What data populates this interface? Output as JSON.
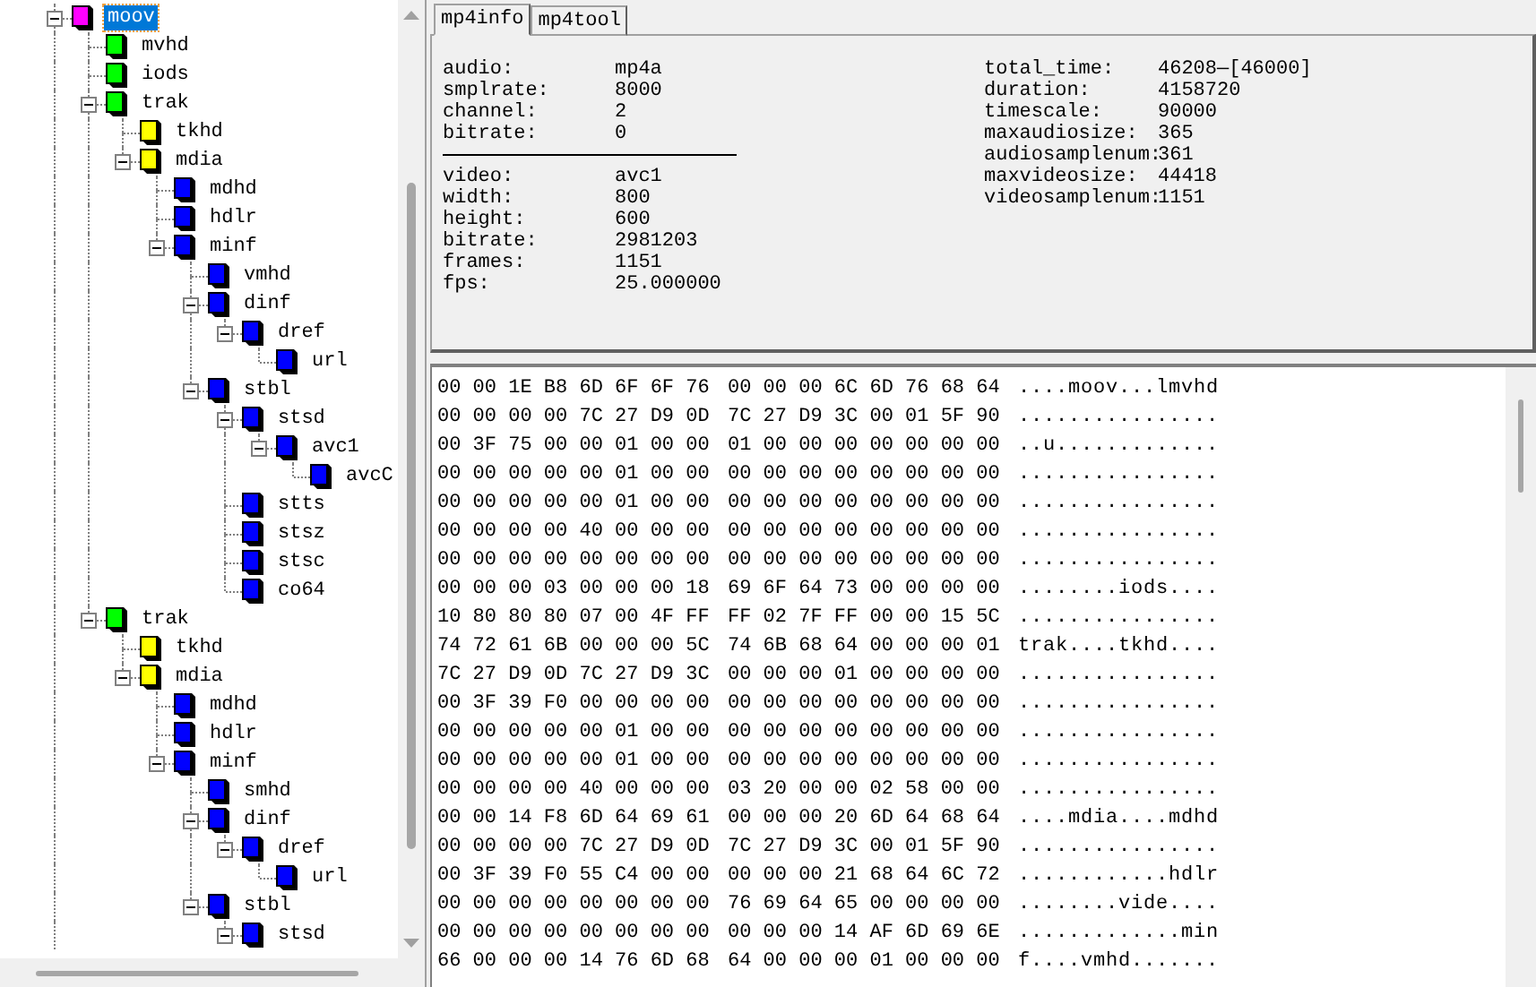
{
  "tree": [
    {
      "label": "moov",
      "color": "#ff00ff",
      "selected": true,
      "expanded": true,
      "children": [
        {
          "label": "mvhd",
          "color": "#00ff00",
          "selected": false
        },
        {
          "label": "iods",
          "color": "#00ff00",
          "selected": false
        },
        {
          "label": "trak",
          "color": "#00ff00",
          "selected": false,
          "expanded": true,
          "children": [
            {
              "label": "tkhd",
              "color": "#ffff00",
              "selected": false
            },
            {
              "label": "mdia",
              "color": "#ffff00",
              "selected": false,
              "expanded": true,
              "children": [
                {
                  "label": "mdhd",
                  "color": "#0000ff",
                  "selected": false
                },
                {
                  "label": "hdlr",
                  "color": "#0000ff",
                  "selected": false
                },
                {
                  "label": "minf",
                  "color": "#0000ff",
                  "selected": false,
                  "expanded": true,
                  "children": [
                    {
                      "label": "vmhd",
                      "color": "#0000ff",
                      "selected": false
                    },
                    {
                      "label": "dinf",
                      "color": "#0000ff",
                      "selected": false,
                      "expanded": true,
                      "children": [
                        {
                          "label": "dref",
                          "color": "#0000ff",
                          "selected": false,
                          "expanded": true,
                          "children": [
                            {
                              "label": "url",
                              "color": "#0000ff",
                              "selected": false
                            }
                          ]
                        }
                      ]
                    },
                    {
                      "label": "stbl",
                      "color": "#0000ff",
                      "selected": false,
                      "expanded": true,
                      "children": [
                        {
                          "label": "stsd",
                          "color": "#0000ff",
                          "selected": false,
                          "expanded": true,
                          "children": [
                            {
                              "label": "avc1",
                              "color": "#0000ff",
                              "selected": false,
                              "expanded": true,
                              "children": [
                                {
                                  "label": "avcC",
                                  "color": "#0000ff",
                                  "selected": false
                                }
                              ]
                            }
                          ]
                        },
                        {
                          "label": "stts",
                          "color": "#0000ff",
                          "selected": false
                        },
                        {
                          "label": "stsz",
                          "color": "#0000ff",
                          "selected": false
                        },
                        {
                          "label": "stsc",
                          "color": "#0000ff",
                          "selected": false
                        },
                        {
                          "label": "co64",
                          "color": "#0000ff",
                          "selected": false
                        }
                      ]
                    }
                  ]
                }
              ]
            }
          ]
        },
        {
          "label": "trak",
          "color": "#00ff00",
          "selected": false,
          "expanded": true,
          "children": [
            {
              "label": "tkhd",
              "color": "#ffff00",
              "selected": false
            },
            {
              "label": "mdia",
              "color": "#ffff00",
              "selected": false,
              "expanded": true,
              "children": [
                {
                  "label": "mdhd",
                  "color": "#0000ff",
                  "selected": false
                },
                {
                  "label": "hdlr",
                  "color": "#0000ff",
                  "selected": false
                },
                {
                  "label": "minf",
                  "color": "#0000ff",
                  "selected": false,
                  "expanded": true,
                  "children": [
                    {
                      "label": "smhd",
                      "color": "#0000ff",
                      "selected": false
                    },
                    {
                      "label": "dinf",
                      "color": "#0000ff",
                      "selected": false,
                      "expanded": true,
                      "children": [
                        {
                          "label": "dref",
                          "color": "#0000ff",
                          "selected": false,
                          "expanded": true,
                          "children": [
                            {
                              "label": "url",
                              "color": "#0000ff",
                              "selected": false
                            }
                          ]
                        }
                      ]
                    },
                    {
                      "label": "stbl",
                      "color": "#0000ff",
                      "selected": false,
                      "expanded": true,
                      "children": [
                        {
                          "label": "stsd",
                          "color": "#0000ff",
                          "selected": false,
                          "expanded": true
                        }
                      ]
                    }
                  ]
                }
              ]
            }
          ]
        }
      ]
    }
  ],
  "tabs": [
    {
      "label": "mp4info",
      "selected": true
    },
    {
      "label": "mp4tool",
      "selected": false
    }
  ],
  "info": {
    "audio": [
      {
        "label": "audio:",
        "value": "mp4a"
      },
      {
        "label": "smplrate:",
        "value": "8000"
      },
      {
        "label": "channel:",
        "value": "2"
      },
      {
        "label": "bitrate:",
        "value": "0"
      }
    ],
    "video": [
      {
        "label": "video:",
        "value": "avc1"
      },
      {
        "label": "width:",
        "value": "800"
      },
      {
        "label": "height:",
        "value": "600"
      },
      {
        "label": "bitrate:",
        "value": "2981203"
      },
      {
        "label": "frames:",
        "value": "1151"
      },
      {
        "label": "fps:",
        "value": "25.000000"
      }
    ],
    "summary": [
      {
        "label": "total_time:",
        "value": "46208—[46000]"
      },
      {
        "label": "duration:",
        "value": "4158720"
      },
      {
        "label": "timescale:",
        "value": "90000"
      },
      {
        "label": "maxaudiosize:",
        "value": "365"
      },
      {
        "label": "audiosamplenum:",
        "value": "361"
      },
      {
        "label": "maxvideosize:",
        "value": "44418"
      },
      {
        "label": "videosamplenum:",
        "value": "1151"
      }
    ]
  },
  "hex_rows": [
    {
      "left": "00 00 1E B8 6D 6F 6F 76",
      "right": "00 00 00 6C 6D 76 68 64",
      "ascii": "....moov...lmvhd"
    },
    {
      "left": "00 00 00 00 7C 27 D9 0D",
      "right": "7C 27 D9 3C 00 01 5F 90",
      "ascii": "................"
    },
    {
      "left": "00 3F 75 00 00 01 00 00",
      "right": "01 00 00 00 00 00 00 00",
      "ascii": "..u............."
    },
    {
      "left": "00 00 00 00 00 01 00 00",
      "right": "00 00 00 00 00 00 00 00",
      "ascii": "................"
    },
    {
      "left": "00 00 00 00 00 01 00 00",
      "right": "00 00 00 00 00 00 00 00",
      "ascii": "................"
    },
    {
      "left": "00 00 00 00 40 00 00 00",
      "right": "00 00 00 00 00 00 00 00",
      "ascii": "................"
    },
    {
      "left": "00 00 00 00 00 00 00 00",
      "right": "00 00 00 00 00 00 00 00",
      "ascii": "................"
    },
    {
      "left": "00 00 00 03 00 00 00 18",
      "right": "69 6F 64 73 00 00 00 00",
      "ascii": "........iods...."
    },
    {
      "left": "10 80 80 80 07 00 4F FF",
      "right": "FF 02 7F FF 00 00 15 5C",
      "ascii": "................"
    },
    {
      "left": "74 72 61 6B 00 00 00 5C",
      "right": "74 6B 68 64 00 00 00 01",
      "ascii": "trak....tkhd...."
    },
    {
      "left": "7C 27 D9 0D 7C 27 D9 3C",
      "right": "00 00 00 01 00 00 00 00",
      "ascii": "................"
    },
    {
      "left": "00 3F 39 F0 00 00 00 00",
      "right": "00 00 00 00 00 00 00 00",
      "ascii": "................"
    },
    {
      "left": "00 00 00 00 00 01 00 00",
      "right": "00 00 00 00 00 00 00 00",
      "ascii": "................"
    },
    {
      "left": "00 00 00 00 00 01 00 00",
      "right": "00 00 00 00 00 00 00 00",
      "ascii": "................"
    },
    {
      "left": "00 00 00 00 40 00 00 00",
      "right": "03 20 00 00 02 58 00 00",
      "ascii": "................"
    },
    {
      "left": "00 00 14 F8 6D 64 69 61",
      "right": "00 00 00 20 6D 64 68 64",
      "ascii": "....mdia....mdhd"
    },
    {
      "left": "00 00 00 00 7C 27 D9 0D",
      "right": "7C 27 D9 3C 00 01 5F 90",
      "ascii": "................"
    },
    {
      "left": "00 3F 39 F0 55 C4 00 00",
      "right": "00 00 00 21 68 64 6C 72",
      "ascii": "............hdlr"
    },
    {
      "left": "00 00 00 00 00 00 00 00",
      "right": "76 69 64 65 00 00 00 00",
      "ascii": "........vide...."
    },
    {
      "left": "00 00 00 00 00 00 00 00",
      "right": "00 00 00 14 AF 6D 69 6E",
      "ascii": ".............min"
    },
    {
      "left": "66 00 00 00 14 76 6D 68",
      "right": "64 00 00 00 01 00 00 00",
      "ascii": "f....vmhd......."
    }
  ]
}
